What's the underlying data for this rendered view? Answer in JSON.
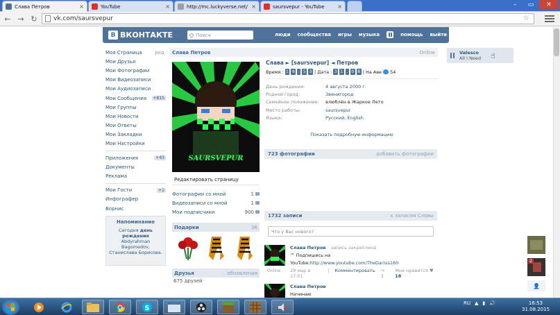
{
  "browser": {
    "tabs": [
      {
        "title": "Слава Петров",
        "icon_color": "#4e729a",
        "active": true
      },
      {
        "title": "YouTube",
        "icon_color": "#e52d27",
        "active": false
      },
      {
        "title": "http://mc.luckyverse.net/",
        "icon_color": "#9aa0a6",
        "active": false
      },
      {
        "title": "saursvepur - YouTube",
        "icon_color": "#e52d27",
        "active": false
      }
    ],
    "url": "vk.com/saursvepur"
  },
  "vk": {
    "logo_text": "ВКОНТАКТЕ",
    "logo_badge": "В",
    "search_placeholder": "Поиск",
    "top_menu": [
      "люди",
      "сообщества",
      "игры",
      "музыка",
      "помощь",
      "выйти"
    ],
    "left_menu": {
      "edit_label": "ред.",
      "group1": [
        {
          "label": "Моя Страница",
          "badge": ""
        },
        {
          "label": "Мои Друзья",
          "badge": ""
        },
        {
          "label": "Мои Фотографии",
          "badge": ""
        },
        {
          "label": "Мои Видеозаписи",
          "badge": ""
        },
        {
          "label": "Мои Аудиозаписи",
          "badge": ""
        },
        {
          "label": "Мои Сообщения",
          "badge": "+815"
        },
        {
          "label": "Мои Группы",
          "badge": ""
        },
        {
          "label": "Мои Новости",
          "badge": ""
        },
        {
          "label": "Мои Ответы",
          "badge": ""
        },
        {
          "label": "Мои Закладки",
          "badge": ""
        },
        {
          "label": "Мои Настройки",
          "badge": ""
        }
      ],
      "group2": [
        {
          "label": "Приложения",
          "badge": "+43"
        },
        {
          "label": "Документы",
          "badge": ""
        },
        {
          "label": "Реклама",
          "badge": ""
        }
      ],
      "group3": [
        {
          "label": "Мои Гости",
          "badge": "+1"
        },
        {
          "label": "Инфографер",
          "badge": ""
        },
        {
          "label": "Ворнис",
          "badge": ""
        }
      ]
    },
    "reminder": {
      "title": "Напоминание",
      "text_prefix": "Сегодня",
      "text_bold": "день рождения",
      "text_rest": "Abdyrahman Bagomedov, Станислава Борисова."
    },
    "profile": {
      "name": "Слава Петров",
      "online": "Online",
      "avatar_caption": "SAURSVEPUR",
      "edit_page": "Редактировать страницу",
      "counts": [
        {
          "label": "Фотографии со мной",
          "value": "1"
        },
        {
          "label": "Видеозаписи со мной",
          "value": "1"
        },
        {
          "label": "Мои подписчики",
          "value": "900"
        }
      ],
      "gifts_label": "Подарки",
      "gifts_count": "36",
      "friends_label": "Друзья",
      "friends_action": "обновления",
      "friends_count": "675 друзей",
      "status_line": "Слава ► [saursvepur] ◄ Петров",
      "time_label": "Время :",
      "time_digits": [
        "1",
        "6",
        ":",
        "5",
        "3"
      ],
      "date_label": "| Дата :",
      "date_digits": [
        "3",
        "1",
        ".",
        "0",
        "8"
      ],
      "vk_label": "| На Аве",
      "vk_value": "54",
      "fields": [
        {
          "key": "День рождения:",
          "value": "4 августа 2000 г."
        },
        {
          "key": "Родной город:",
          "value": "Звенигород"
        },
        {
          "key": "Семейное положение:",
          "value": "влюблён в Жаркое Лето"
        },
        {
          "key": "Место работы:",
          "value": "saursvepur"
        },
        {
          "key": "Языки:",
          "value": "Русский, English"
        }
      ],
      "more_info": "Показать подробную информацию",
      "photos_title": "723 фотографии",
      "photos_action": "добавить фотографии",
      "wall_title": "1732 записи",
      "wall_action": "к записям Славы",
      "wall_placeholder": "Что у Вас нового?"
    },
    "posts": [
      {
        "author": "Слава Петров",
        "meta": "запись закреплена",
        "line1": "™ Подпишись на",
        "link_prefix": "YouTube:",
        "link": "http://www.youtube.com/TheDarius160",
        "date": "29 мар в 17:01",
        "comment": "Комментировать",
        "reposts": "3",
        "likes_label": "Мне нравится",
        "likes": "18",
        "online": "Online"
      },
      {
        "author": "Слава Петров",
        "line1": "Начинаю"
      }
    ],
    "player": {
      "artist": "Valesco",
      "song": "All I Need"
    }
  },
  "taskbar": {
    "lang": "RU",
    "time": "16:53",
    "date": "31.08.2015"
  },
  "colors": {
    "vk_blue": "#4e729a",
    "link": "#2b587a",
    "accent_green": "#2aff55"
  }
}
